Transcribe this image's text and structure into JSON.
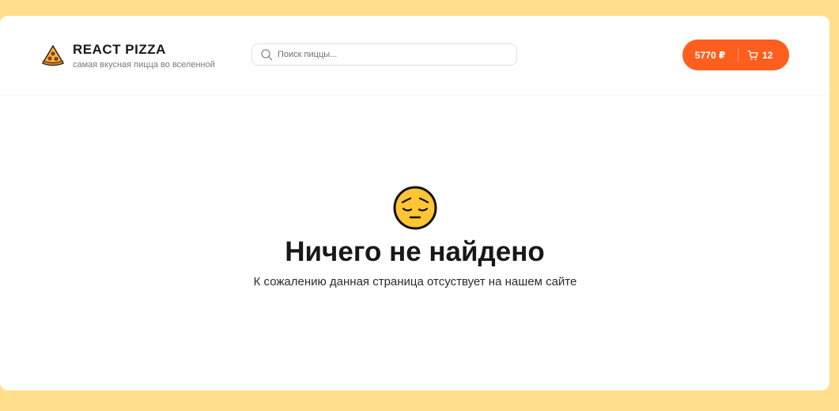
{
  "header": {
    "logo_title": "REACT PIZZA",
    "logo_subtitle": "самая вкусная пицца во вселенной",
    "logo_icon": "pizza-icon",
    "search": {
      "placeholder": "Поиск пиццы...",
      "value": ""
    },
    "cart": {
      "price": "5770 ₽",
      "count": "12",
      "icon": "cart-icon"
    }
  },
  "not_found": {
    "emoji_icon": "pensive-face-icon",
    "title": "Ничего не найдено",
    "description": "К сожалению данная страница отсуствует на нашем сайте"
  },
  "colors": {
    "page_background": "#ffdf8c",
    "accent": "#fe5f1e",
    "card_background": "#ffffff"
  }
}
